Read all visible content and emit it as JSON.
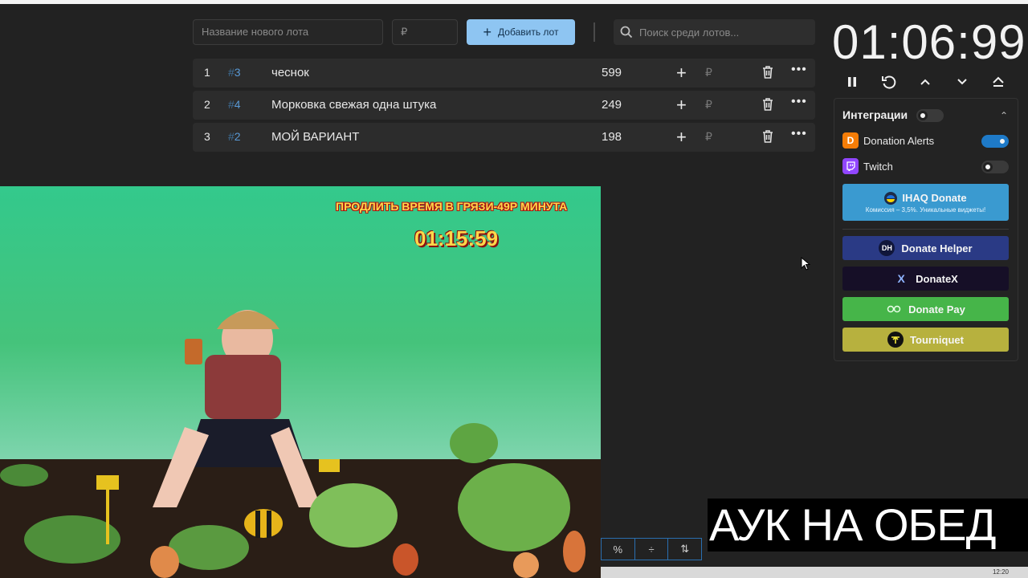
{
  "toolbar": {
    "lot_name_placeholder": "Название нового лота",
    "price_placeholder": "₽",
    "add_button_label": "Добавить лот",
    "search_placeholder": "Поиск среди лотов..."
  },
  "lots": [
    {
      "index": "1",
      "hash": "#",
      "id": "3",
      "name": "чеснок",
      "amount": "599",
      "currency": "₽"
    },
    {
      "index": "2",
      "hash": "#",
      "id": "4",
      "name": "Морковка свежая одна штука",
      "amount": "249",
      "currency": "₽"
    },
    {
      "index": "3",
      "hash": "#",
      "id": "2",
      "name": "МОЙ ВАРИАНТ",
      "amount": "198",
      "currency": "₽"
    }
  ],
  "timer": {
    "value": "01:06:99",
    "controls": [
      "pause-icon",
      "reset-icon",
      "chevron-up-icon",
      "chevron-down-icon",
      "eject-icon"
    ]
  },
  "integrations": {
    "title": "Интеграции",
    "enabled": false,
    "items": [
      {
        "label": "Donation Alerts",
        "enabled": true,
        "icon": "donation-alerts-icon",
        "color": "#f57d07"
      },
      {
        "label": "Twitch",
        "enabled": false,
        "icon": "twitch-icon",
        "color": "#9146ff"
      }
    ],
    "ihaq": {
      "label": "IHAQ Donate",
      "subtitle": "Комиссия – 3,5%. Уникальные виджеты!"
    },
    "buttons": [
      {
        "label": "Donate Helper",
        "icon": "DH"
      },
      {
        "label": "DonateX",
        "icon": "X"
      },
      {
        "label": "Donate Pay",
        "icon": "donatepay-icon"
      },
      {
        "label": "Tourniquet",
        "icon": "tourniquet-icon"
      }
    ]
  },
  "stream": {
    "overlay_text": "ПРОДЛИТЬ ВРЕМЯ В ГРЯЗИ-49Р МИНУТА",
    "overlay_timer": "01:15:59"
  },
  "video_tools": [
    "%",
    "÷",
    "⇅"
  ],
  "caption": "АУК НА ОБЕД",
  "taskbar_clock": "12:20"
}
